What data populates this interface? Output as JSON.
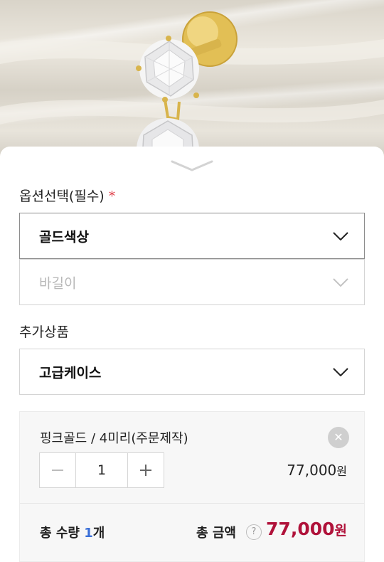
{
  "option_section": {
    "label": "옵션선택(필수)",
    "required_mark": "*",
    "selects": [
      {
        "value": "골드색상",
        "state": "active"
      },
      {
        "value": "바길이",
        "state": "disabled"
      }
    ]
  },
  "addon_section": {
    "label": "추가상품",
    "select": {
      "value": "고급케이스"
    }
  },
  "selected_item": {
    "name": "핑크골드 / 4미리(주문제작)",
    "remove_icon": "close-icon",
    "quantity": "1",
    "price": "77,000",
    "currency": "원"
  },
  "summary": {
    "qty_label": "총 수량",
    "qty_value": "1",
    "qty_unit": "개",
    "total_label": "총 금액",
    "help_symbol": "?",
    "total_price": "77,000",
    "currency": "원"
  },
  "colors": {
    "accent_price": "#b0123a",
    "qty_number": "#3a6fd8",
    "required": "#e0404a"
  }
}
